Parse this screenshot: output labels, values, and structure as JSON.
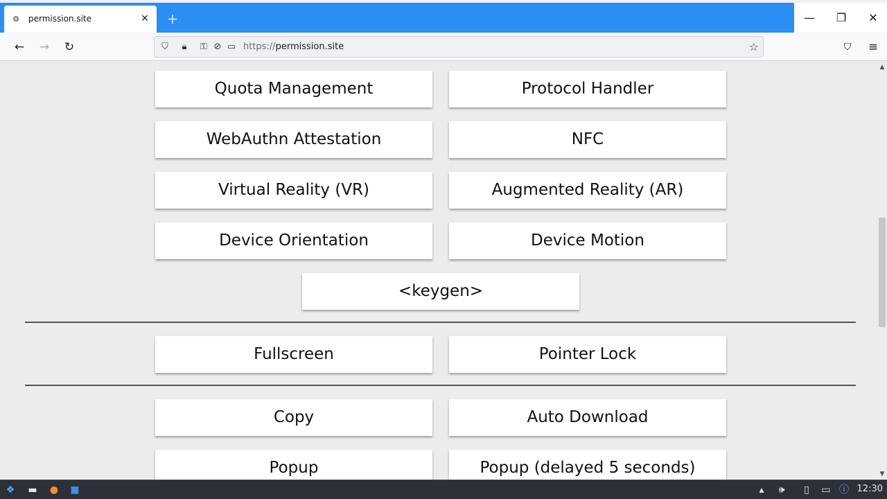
{
  "browser": {
    "tab": {
      "title": "permission.site",
      "favicon": "permission-site-favicon",
      "close_icon": "close-icon"
    },
    "new_tab_icon": "plus-icon",
    "window_controls": {
      "minimize": "—",
      "maximize": "❐",
      "close": "✕"
    },
    "nav": {
      "back": "←",
      "forward": "→",
      "reload": "↻"
    },
    "address": {
      "scheme": "https://",
      "host": "permission.site"
    }
  },
  "buttons": {
    "quota": "Quota Management",
    "protocol": "Protocol Handler",
    "webauthn": "WebAuthn Attestation",
    "nfc": "NFC",
    "vr": "Virtual Reality (VR)",
    "ar": "Augmented Reality (AR)",
    "orientation": "Device Orientation",
    "motion": "Device Motion",
    "keygen": "<keygen>",
    "fullscreen": "Fullscreen",
    "pointer_lock": "Pointer Lock",
    "copy": "Copy",
    "auto_download": "Auto Download",
    "popup": "Popup",
    "popup_delayed": "Popup (delayed 5 seconds)"
  },
  "taskbar": {
    "clock": "12:30"
  },
  "colors": {
    "tabstrip": "#2b8ef3",
    "page_bg": "#ececec",
    "taskbar": "#2c3039"
  }
}
